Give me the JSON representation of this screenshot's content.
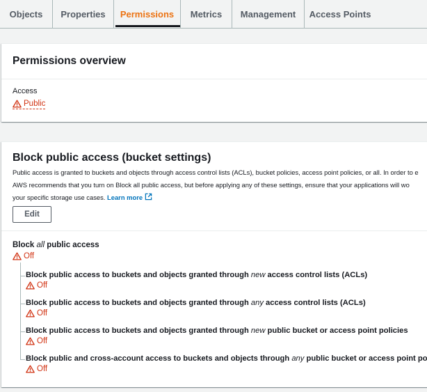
{
  "tabs": [
    {
      "label": "Objects"
    },
    {
      "label": "Properties"
    },
    {
      "label": "Permissions"
    },
    {
      "label": "Metrics"
    },
    {
      "label": "Management"
    },
    {
      "label": "Access Points"
    }
  ],
  "active_tab": "Permissions",
  "overview": {
    "title": "Permissions overview",
    "access_label": "Access",
    "access_value": "Public"
  },
  "block_public_access": {
    "title": "Block public access (bucket settings)",
    "description_line1": "Public access is granted to buckets and objects through access control lists (ACLs), bucket policies, access point policies, or all. In order to e",
    "description_line2": "AWS recommends that you turn on Block all public access, but before applying any of these settings, ensure that your applications will wo",
    "description_line3": "your specific storage use cases.",
    "learn_more": "Learn more",
    "edit_label": "Edit",
    "block_all": {
      "prefix": "Block ",
      "emph": "all",
      "suffix": " public access",
      "status": "Off"
    },
    "settings": [
      {
        "prefix": "Block public access to buckets and objects granted through ",
        "emph": "new",
        "suffix": " access control lists (ACLs)",
        "status": "Off"
      },
      {
        "prefix": "Block public access to buckets and objects granted through ",
        "emph": "any",
        "suffix": " access control lists (ACLs)",
        "status": "Off"
      },
      {
        "prefix": "Block public access to buckets and objects granted through ",
        "emph": "new",
        "suffix": " public bucket or access point policies",
        "status": "Off"
      },
      {
        "prefix": "Block public and cross-account access to buckets and objects through ",
        "emph": "any",
        "suffix": " public bucket or access point policie",
        "status": "Off"
      }
    ]
  },
  "colors": {
    "accent_orange": "#ec7211",
    "warning_red": "#d13212",
    "link_blue": "#0073bb"
  },
  "icons": {
    "warning": "warning-triangle-icon",
    "external": "external-link-icon"
  }
}
